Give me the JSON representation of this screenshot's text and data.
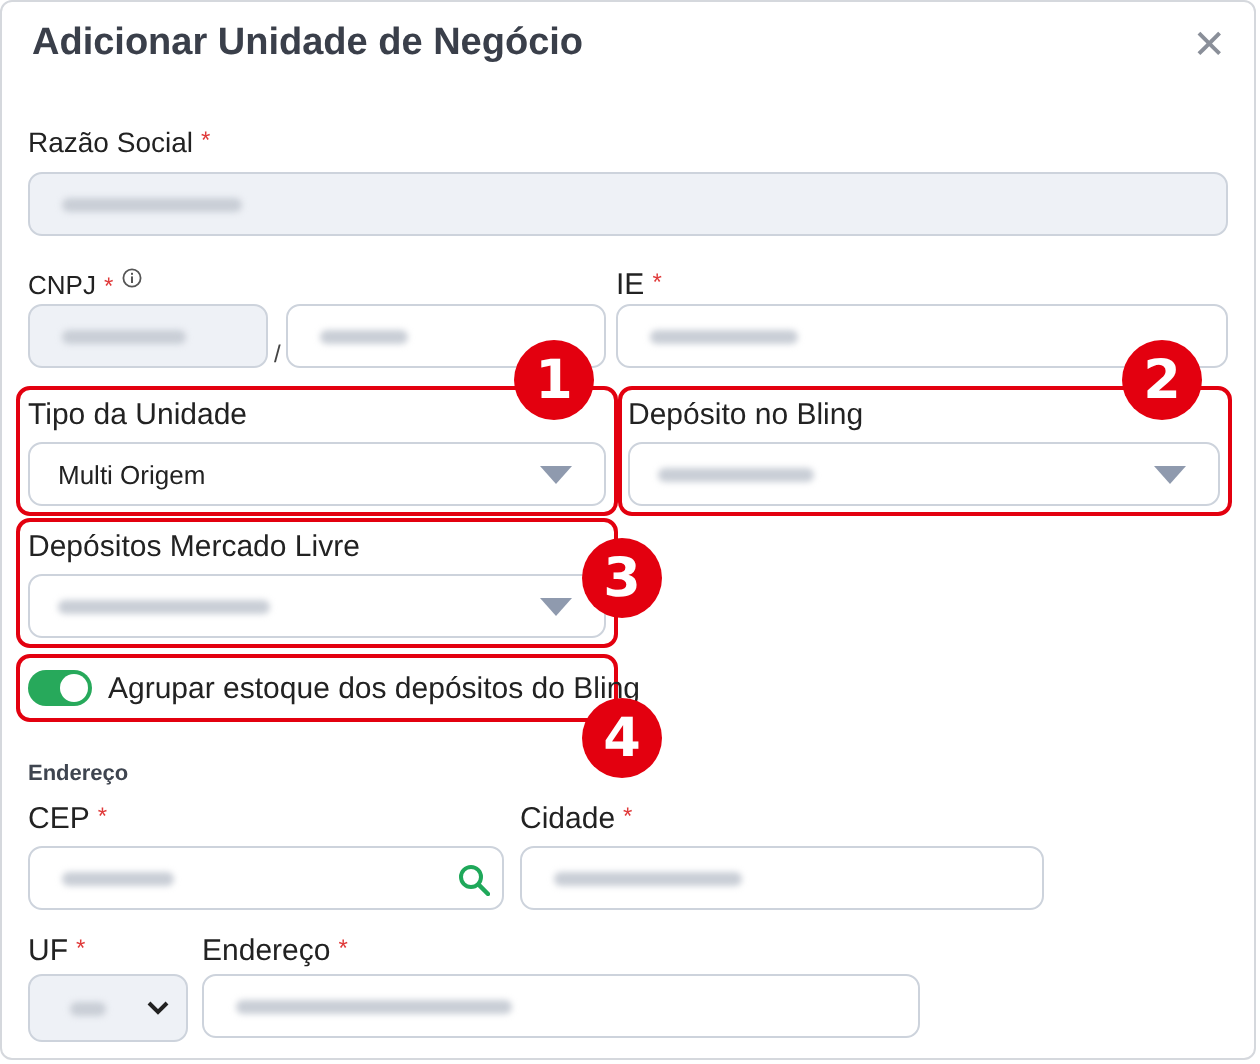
{
  "modal": {
    "title": "Adicionar Unidade de Negócio",
    "close": "✕"
  },
  "razao_social": {
    "label": "Razão Social",
    "required_mark": "*",
    "redacted": true,
    "disabled": true
  },
  "cnpj": {
    "label": "CNPJ",
    "required_mark": "*",
    "part_1": {
      "redacted": true,
      "disabled": true
    },
    "separator": "/",
    "part_2": {
      "redacted": true,
      "disabled": false
    }
  },
  "ie": {
    "label": "IE",
    "required_mark": "*",
    "redacted": true
  },
  "tipo_da_unidade": {
    "label": "Tipo da Unidade",
    "value": "Multi Origem"
  },
  "deposito_no_bling": {
    "label": "Depósito no Bling",
    "redacted": true
  },
  "depositos_mercado_livre": {
    "label": "Depósitos Mercado Livre",
    "redacted": true
  },
  "agrupar_estoque": {
    "label": "Agrupar estoque dos depósitos do Bling",
    "on": true
  },
  "section_title": "Endereço",
  "cep": {
    "label": "CEP",
    "required_mark": "*",
    "redacted": true
  },
  "cidade": {
    "label": "Cidade",
    "required_mark": "*",
    "redacted": true
  },
  "uf": {
    "label": "UF",
    "required_mark": "*",
    "redacted": true,
    "disabled": true
  },
  "endereco": {
    "label": "Endereço",
    "required_mark": "*",
    "redacted": true
  },
  "annotations": [
    {
      "label": "1"
    },
    {
      "label": "2"
    },
    {
      "label": "3"
    },
    {
      "label": "4"
    }
  ]
}
